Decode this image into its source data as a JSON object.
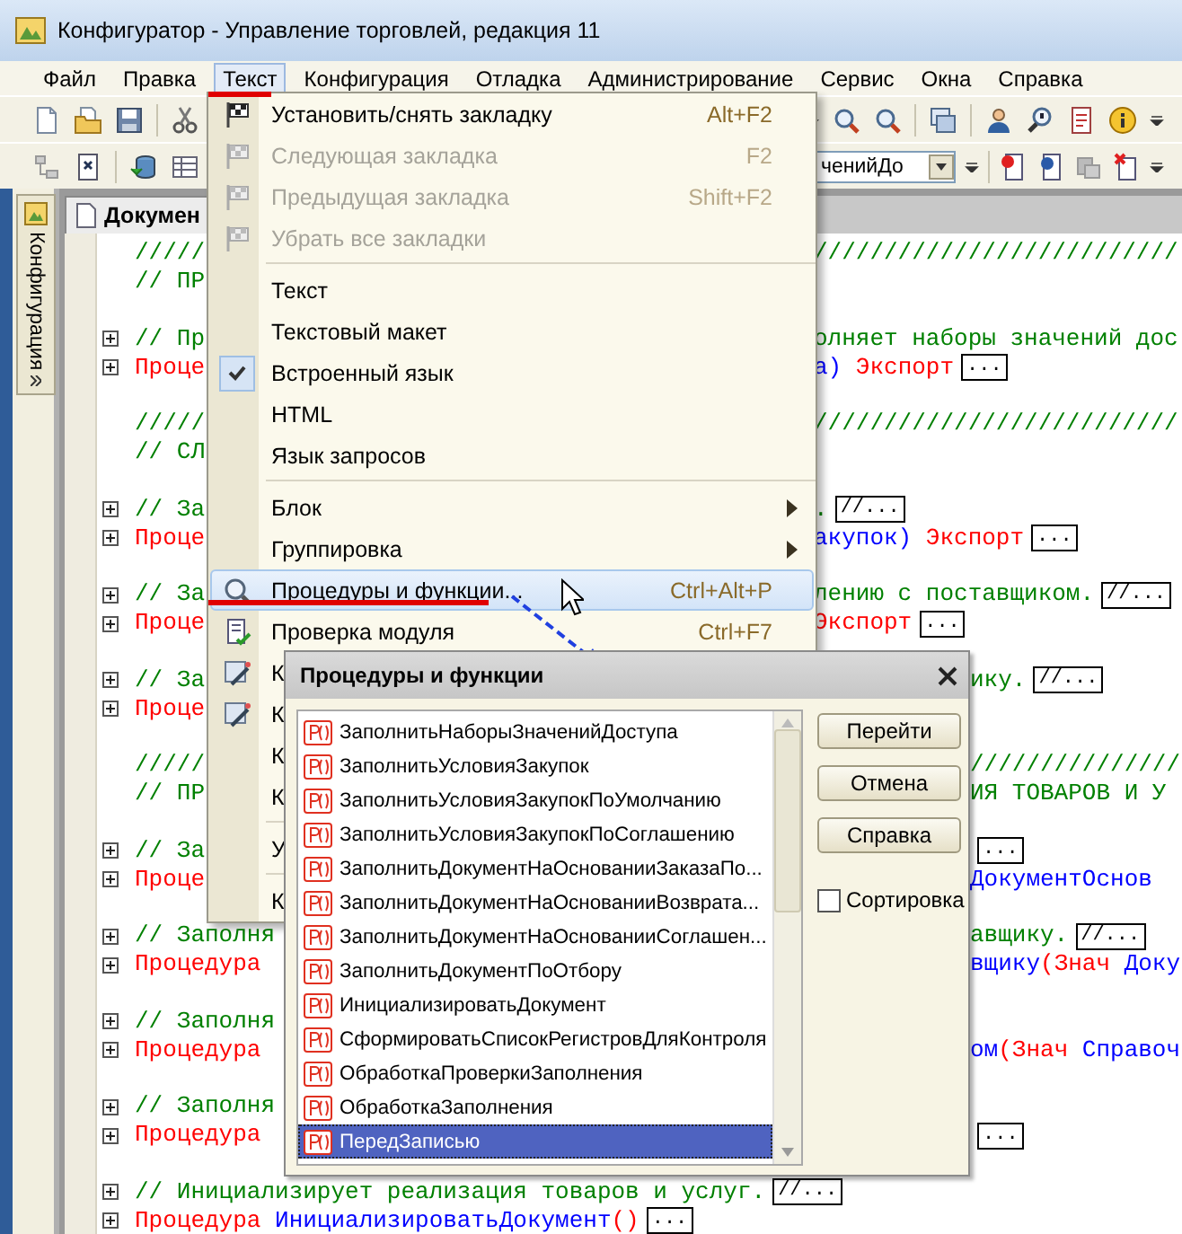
{
  "window": {
    "title": "Конфигуратор - Управление торговлей, редакция 11"
  },
  "menubar": [
    {
      "label": "Файл",
      "selected": false
    },
    {
      "label": "Правка",
      "selected": false
    },
    {
      "label": "Текст",
      "selected": true
    },
    {
      "label": "Конфигурация",
      "selected": false
    },
    {
      "label": "Отладка",
      "selected": false
    },
    {
      "label": "Администрирование",
      "selected": false
    },
    {
      "label": "Сервис",
      "selected": false
    },
    {
      "label": "Окна",
      "selected": false
    },
    {
      "label": "Справка",
      "selected": false
    }
  ],
  "toolbar_combo": {
    "value": "ченийДо"
  },
  "side_panel": {
    "label": "Конфигурация"
  },
  "document_tab": {
    "label": "Докумен"
  },
  "code": {
    "blocks": [
      [
        {
          "fold": false,
          "left": [
            {
              "kind": "comment",
              "text": "/////"
            }
          ],
          "right": [
            {
              "kind": "comment",
              "text": "//////////////////////////"
            }
          ]
        },
        {
          "fold": false,
          "left": [
            {
              "kind": "comment",
              "text": "// ПР"
            }
          ]
        }
      ],
      [
        {
          "fold": true,
          "left": [
            {
              "kind": "comment",
              "text": "// Пр"
            }
          ],
          "right": [
            {
              "kind": "comment",
              "text": "олняет наборы значений дос"
            }
          ]
        },
        {
          "fold": true,
          "left": [
            {
              "kind": "keyword",
              "text": "Проце"
            }
          ],
          "right": [
            {
              "kind": "name",
              "text": "а)"
            },
            {
              "kind": "keyword",
              "text": " Экспорт"
            },
            {
              "kind": "collapsed",
              "text": "..."
            }
          ]
        }
      ],
      [
        {
          "fold": false,
          "left": [
            {
              "kind": "comment",
              "text": "/////"
            }
          ],
          "right": [
            {
              "kind": "comment",
              "text": "//////////////////////////"
            }
          ]
        },
        {
          "fold": false,
          "left": [
            {
              "kind": "comment",
              "text": "// СЛ"
            }
          ]
        }
      ],
      [
        {
          "fold": true,
          "left": [
            {
              "kind": "comment",
              "text": "// За"
            }
          ],
          "right": [
            {
              "kind": "comment",
              "text": "."
            },
            {
              "kind": "collapsed",
              "text": "//..."
            }
          ]
        },
        {
          "fold": true,
          "left": [
            {
              "kind": "keyword",
              "text": "Проце"
            }
          ],
          "right": [
            {
              "kind": "name",
              "text": "акупок)"
            },
            {
              "kind": "keyword",
              "text": " Экспорт"
            },
            {
              "kind": "collapsed",
              "text": "..."
            }
          ]
        }
      ],
      [
        {
          "fold": true,
          "left": [
            {
              "kind": "comment",
              "text": "// За"
            }
          ],
          "right": [
            {
              "kind": "comment",
              "text": "лению с поставщиком."
            },
            {
              "kind": "collapsed",
              "text": "//..."
            }
          ]
        },
        {
          "fold": true,
          "left": [
            {
              "kind": "keyword",
              "text": "Проце"
            }
          ],
          "right": [
            {
              "kind": "keyword",
              "text": "Экспорт"
            },
            {
              "kind": "collapsed",
              "text": "..."
            }
          ]
        }
      ],
      [
        {
          "fold": true,
          "left": [
            {
              "kind": "comment",
              "text": "// За"
            }
          ],
          "right": [
            {
              "kind": "comment",
              "text": "ику."
            },
            {
              "kind": "collapsed",
              "text": "//..."
            }
          ]
        },
        {
          "fold": true,
          "left": [
            {
              "kind": "keyword",
              "text": "Проце"
            }
          ]
        }
      ],
      [
        {
          "fold": false,
          "left": [
            {
              "kind": "comment",
              "text": "/////"
            }
          ],
          "right": [
            {
              "kind": "comment",
              "text": "///////////////"
            }
          ]
        },
        {
          "fold": false,
          "left": [
            {
              "kind": "comment",
              "text": "// ПР"
            }
          ],
          "right": [
            {
              "kind": "comment",
              "text": "ИЯ ТОВАРОВ И У"
            }
          ]
        }
      ],
      [
        {
          "fold": true,
          "left": [
            {
              "kind": "comment",
              "text": "// За"
            }
          ],
          "right": [
            {
              "kind": "collapsed",
              "text": "..."
            }
          ]
        },
        {
          "fold": true,
          "left": [
            {
              "kind": "keyword",
              "text": "Проце"
            }
          ],
          "right": [
            {
              "kind": "name",
              "text": "ДокументОснов"
            }
          ]
        }
      ],
      [
        {
          "fold": true,
          "left": [
            {
              "kind": "comment",
              "text": "// Заполня"
            }
          ],
          "right": [
            {
              "kind": "comment",
              "text": "авщику."
            },
            {
              "kind": "collapsed",
              "text": "//..."
            }
          ]
        },
        {
          "fold": true,
          "left": [
            {
              "kind": "keyword",
              "text": "Процедура"
            }
          ],
          "right": [
            {
              "kind": "name",
              "text": "вщику"
            },
            {
              "kind": "keyword",
              "text": "(Знач"
            },
            {
              "kind": "name",
              "text": " Доку"
            }
          ]
        }
      ],
      [
        {
          "fold": true,
          "left": [
            {
              "kind": "comment",
              "text": "// Заполня"
            }
          ]
        },
        {
          "fold": true,
          "left": [
            {
              "kind": "keyword",
              "text": "Процедура"
            }
          ],
          "right": [
            {
              "kind": "name",
              "text": "ом"
            },
            {
              "kind": "keyword",
              "text": "(Знач"
            },
            {
              "kind": "name",
              "text": " Справоч"
            }
          ]
        }
      ],
      [
        {
          "fold": true,
          "left": [
            {
              "kind": "comment",
              "text": "// Заполня"
            }
          ]
        },
        {
          "fold": true,
          "left": [
            {
              "kind": "keyword",
              "text": "Процедура"
            }
          ],
          "right": [
            {
              "kind": "collapsed",
              "text": "..."
            }
          ]
        }
      ],
      [
        {
          "fold": true,
          "left": [
            {
              "kind": "comment",
              "text": "// Инициализирует реализация товаров и услуг."
            },
            {
              "kind": "collapsed",
              "text": "//..."
            }
          ]
        },
        {
          "fold": true,
          "left": [
            {
              "kind": "keyword",
              "text": "Процедура "
            },
            {
              "kind": "name",
              "text": "ИнициализироватьДокумент"
            },
            {
              "kind": "keyword",
              "text": "()"
            },
            {
              "kind": "collapsed",
              "text": "..."
            }
          ]
        }
      ]
    ]
  },
  "menu": {
    "items": [
      {
        "kind": "item",
        "label": "Установить/снять закладку",
        "shortcut": "Alt+F2",
        "disabled": false,
        "checked": false,
        "submenu": false,
        "selected": false
      },
      {
        "kind": "item",
        "label": "Следующая закладка",
        "shortcut": "F2",
        "disabled": true,
        "checked": false,
        "submenu": false,
        "selected": false
      },
      {
        "kind": "item",
        "label": "Предыдущая закладка",
        "shortcut": "Shift+F2",
        "disabled": true,
        "checked": false,
        "submenu": false,
        "selected": false
      },
      {
        "kind": "item",
        "label": "Убрать все закладки",
        "disabled": true,
        "checked": false,
        "submenu": false,
        "selected": false
      },
      {
        "kind": "separator"
      },
      {
        "kind": "item",
        "label": "Текст",
        "disabled": false,
        "checked": false,
        "submenu": false,
        "selected": false
      },
      {
        "kind": "item",
        "label": "Текстовый макет",
        "disabled": false,
        "checked": false,
        "submenu": false,
        "selected": false
      },
      {
        "kind": "item",
        "label": "Встроенный язык",
        "disabled": false,
        "checked": true,
        "submenu": false,
        "selected": false
      },
      {
        "kind": "item",
        "label": "HTML",
        "disabled": false,
        "checked": false,
        "submenu": false,
        "selected": false
      },
      {
        "kind": "item",
        "label": "Язык запросов",
        "disabled": false,
        "checked": false,
        "submenu": false,
        "selected": false
      },
      {
        "kind": "separator"
      },
      {
        "kind": "item",
        "label": "Блок",
        "disabled": false,
        "checked": false,
        "submenu": true,
        "selected": false
      },
      {
        "kind": "item",
        "label": "Группировка",
        "disabled": false,
        "checked": false,
        "submenu": true,
        "selected": false
      },
      {
        "kind": "item",
        "label": "Процедуры и функции...",
        "shortcut": "Ctrl+Alt+P",
        "disabled": false,
        "checked": false,
        "submenu": false,
        "selected": true
      },
      {
        "kind": "item",
        "label": "Проверка модуля",
        "shortcut": "Ctrl+F7",
        "disabled": false,
        "checked": false,
        "submenu": false,
        "selected": false
      },
      {
        "kind": "item",
        "label": "К",
        "disabled": false,
        "checked": false,
        "submenu": false,
        "selected": false
      },
      {
        "kind": "item",
        "label": "К",
        "disabled": false,
        "checked": false,
        "submenu": false,
        "selected": false
      },
      {
        "kind": "item",
        "label": "К",
        "disabled": false,
        "checked": false,
        "submenu": false,
        "selected": false
      },
      {
        "kind": "item",
        "label": "К",
        "disabled": false,
        "checked": false,
        "submenu": false,
        "selected": false
      },
      {
        "kind": "separator"
      },
      {
        "kind": "item",
        "label": "У",
        "disabled": false,
        "checked": false,
        "submenu": false,
        "selected": false
      },
      {
        "kind": "separator"
      },
      {
        "kind": "item",
        "label": "К",
        "disabled": false,
        "checked": false,
        "submenu": false,
        "selected": false
      }
    ]
  },
  "dialog": {
    "title": "Процедуры и функции",
    "items": [
      {
        "label": "ЗаполнитьНаборыЗначенийДоступа",
        "selected": false
      },
      {
        "label": "ЗаполнитьУсловияЗакупок",
        "selected": false
      },
      {
        "label": "ЗаполнитьУсловияЗакупокПоУмолчанию",
        "selected": false
      },
      {
        "label": "ЗаполнитьУсловияЗакупокПоСоглашению",
        "selected": false
      },
      {
        "label": "ЗаполнитьДокументНаОснованииЗаказаПо...",
        "selected": false
      },
      {
        "label": "ЗаполнитьДокументНаОснованииВозврата...",
        "selected": false
      },
      {
        "label": "ЗаполнитьДокументНаОснованииСоглашен...",
        "selected": false
      },
      {
        "label": "ЗаполнитьДокументПоОтбору",
        "selected": false
      },
      {
        "label": "ИнициализироватьДокумент",
        "selected": false
      },
      {
        "label": "СформироватьСписокРегистровДляКонтроля",
        "selected": false
      },
      {
        "label": "ОбработкаПроверкиЗаполнения",
        "selected": false
      },
      {
        "label": "ОбработкаЗаполнения",
        "selected": false
      },
      {
        "label": "ПередЗаписью",
        "selected": true
      }
    ],
    "buttons": [
      "Перейти",
      "Отмена",
      "Справка"
    ],
    "sort": {
      "label": "Сортировка",
      "checked": false
    }
  }
}
